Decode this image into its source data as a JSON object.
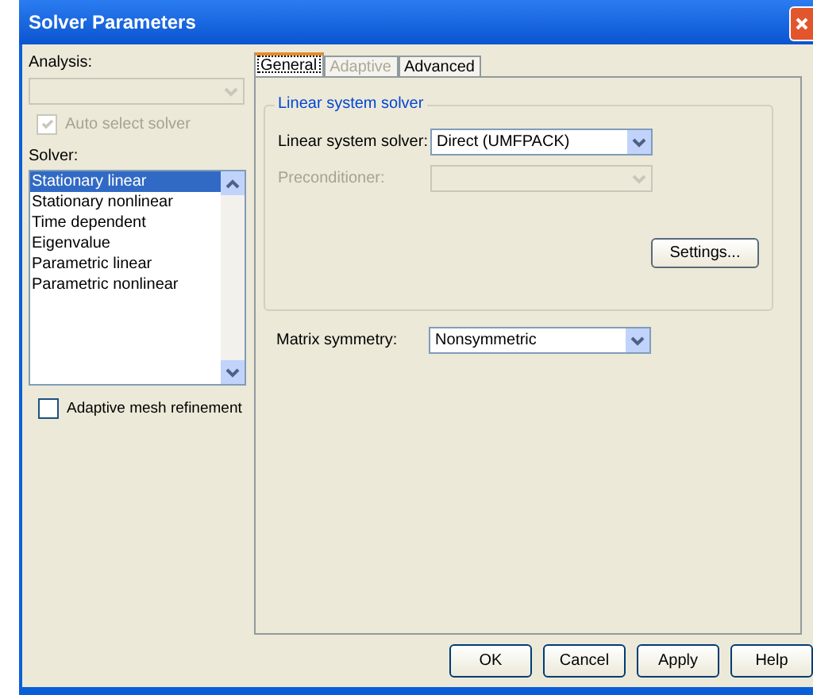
{
  "window": {
    "title": "Solver Parameters"
  },
  "analysis": {
    "label": "Analysis:",
    "disabled": true
  },
  "auto_select": {
    "label": "Auto select solver",
    "checked": true,
    "disabled": true
  },
  "solver": {
    "label": "Solver:",
    "items": [
      {
        "label": "Stationary linear",
        "selected": true
      },
      {
        "label": "Stationary nonlinear",
        "selected": false
      },
      {
        "label": "Time dependent",
        "selected": false
      },
      {
        "label": "Eigenvalue",
        "selected": false
      },
      {
        "label": "Parametric linear",
        "selected": false
      },
      {
        "label": "Parametric nonlinear",
        "selected": false
      }
    ]
  },
  "adaptive_mesh": {
    "label": "Adaptive mesh refinement",
    "checked": false
  },
  "tabs": [
    {
      "label": "General",
      "selected": true,
      "disabled": false
    },
    {
      "label": "Adaptive",
      "selected": false,
      "disabled": true
    },
    {
      "label": "Advanced",
      "selected": false,
      "disabled": false
    }
  ],
  "group": {
    "title": "Linear system solver",
    "fields": [
      {
        "label": "Linear system solver:",
        "value": "Direct (UMFPACK)",
        "disabled": false
      },
      {
        "label": "Preconditioner:",
        "disabled": true
      }
    ],
    "button": "Settings..."
  },
  "matrix_symmetry": {
    "label": "Matrix symmetry:",
    "value": "Nonsymmetric"
  },
  "buttons": [
    "OK",
    "Cancel",
    "Apply",
    "Help"
  ]
}
